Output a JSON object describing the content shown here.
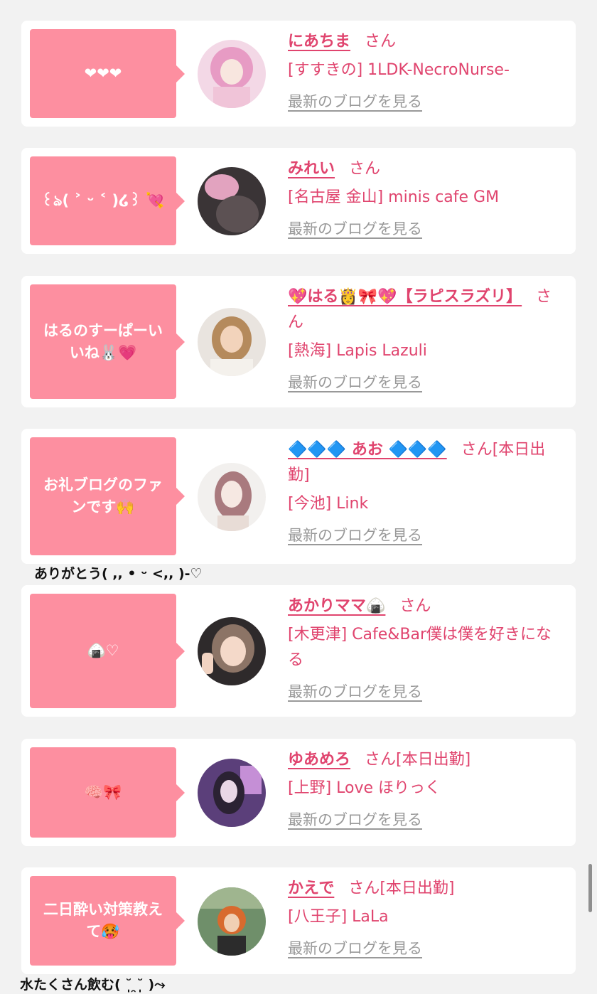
{
  "items": [
    {
      "message": "❤︎❤︎❤︎",
      "name": "にあちま",
      "honorific": "さん",
      "shop": "[すすきの] 1LDK-NecroNurse-",
      "blog_link": "最新のブログを見る",
      "avatar": "avatar-pink-hair"
    },
    {
      "message": "꒰ঌ( ˃ ᵕ ˂ )໒꒱ 💘",
      "name": "みれい",
      "honorific": "さん",
      "shop": "[名古屋 金山] minis cafe GM",
      "blog_link": "最新のブログを見る",
      "avatar": "avatar-blurred"
    },
    {
      "message": "はるのすーぱーいいね🐰💗",
      "name": "💖はる👸🎀💖【ラピスラズリ】",
      "honorific": "さん",
      "shop": "[熱海] Lapis Lazuli",
      "blog_link": "最新のブログを見る",
      "avatar": "avatar-blonde"
    },
    {
      "message": "お礼ブログのファンです🙌",
      "name": "🔷🔷🔷 あお 🔷🔷🔷",
      "honorific": "さん[本日出勤]",
      "shop": "[今池] Link",
      "blog_link": "最新のブログを見る",
      "avatar": "avatar-illustration"
    },
    {
      "message": "🍙♡",
      "name": "あかりママ🍙",
      "honorific": "さん",
      "shop": "[木更津] Cafe&Bar僕は僕を好きになる",
      "blog_link": "最新のブログを見る",
      "avatar": "avatar-peace-sign"
    },
    {
      "message": "🧠🎀",
      "name": "ゆあめろ",
      "honorific": "さん[本日出勤]",
      "shop": "[上野] Love ほりっく",
      "blog_link": "最新のブログを見る",
      "avatar": "avatar-purple-room"
    },
    {
      "message": "二日酔い対策教えて🥵",
      "name": "かえで",
      "honorific": "さん[本日出勤]",
      "shop": "[八王子] LaLa",
      "blog_link": "最新のブログを見る",
      "avatar": "avatar-outdoor"
    }
  ],
  "comments": {
    "c1": "ありがとう( ,, • ᵕ <,, )-♡",
    "c2": "水たくさん飲む( ˘̩̩̩ ̯˘̩̩̩ )⤳"
  },
  "colors": {
    "accent": "#e0446e",
    "bubble": "#fd8fa0",
    "link_gray": "#999999",
    "background": "#f2f2f2"
  }
}
